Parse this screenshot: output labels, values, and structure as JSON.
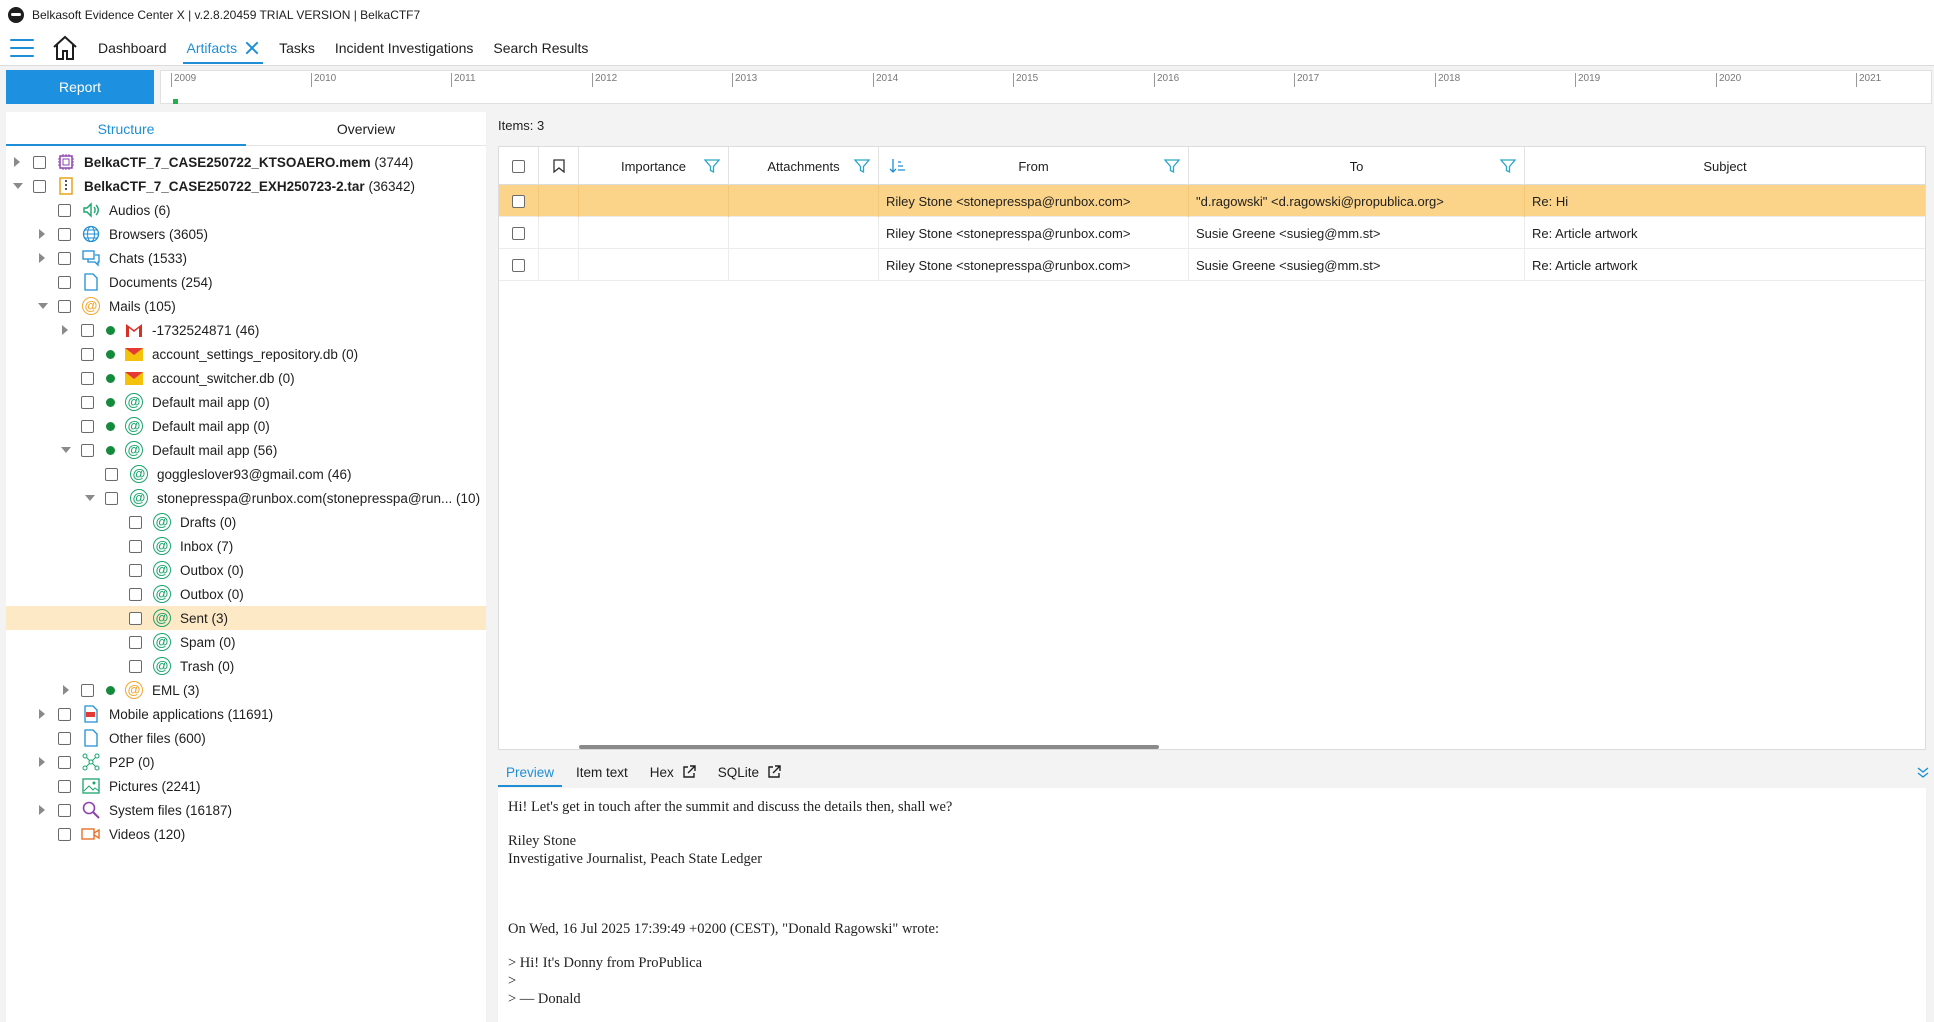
{
  "window": {
    "title": "Belkasoft Evidence Center X | v.2.8.20459 TRIAL VERSION | BelkaCTF7"
  },
  "nav": {
    "tabs": [
      {
        "label": "Dashboard"
      },
      {
        "label": "Artifacts"
      },
      {
        "label": "Tasks"
      },
      {
        "label": "Incident Investigations"
      },
      {
        "label": "Search Results"
      }
    ]
  },
  "report_button": "Report",
  "timeline": {
    "years": [
      "2009",
      "2010",
      "2011",
      "2012",
      "2013",
      "2014",
      "2015",
      "2016",
      "2017",
      "2018",
      "2019",
      "2020",
      "2021"
    ]
  },
  "left_panel": {
    "tabs": [
      {
        "label": "Structure"
      },
      {
        "label": "Overview"
      }
    ],
    "tree": [
      {
        "name": "BelkaCTF_7_CASE250722_KTSOAERO.mem",
        "count": "(3744)",
        "icon": "memory-chip-icon"
      },
      {
        "name": "BelkaCTF_7_CASE250722_EXH250723-2.tar",
        "count": "(36342)",
        "icon": "archive-icon"
      },
      {
        "label": "Audios (6)",
        "icon": "speaker-icon"
      },
      {
        "label": "Browsers (3605)",
        "icon": "globe-icon"
      },
      {
        "label": "Chats (1533)",
        "icon": "chat-icon"
      },
      {
        "label": "Documents (254)",
        "icon": "document-icon"
      },
      {
        "label": "Mails (105)",
        "icon": "at-icon"
      },
      {
        "label": "-1732524871 (46)",
        "icon": "gmail-icon"
      },
      {
        "label": "account_settings_repository.db (0)",
        "icon": "envelope-icon"
      },
      {
        "label": "account_switcher.db (0)",
        "icon": "envelope-icon"
      },
      {
        "label": "Default mail app (0)",
        "icon": "at-icon"
      },
      {
        "label": "Default mail app (0)",
        "icon": "at-icon"
      },
      {
        "label": "Default mail app (56)",
        "icon": "at-icon"
      },
      {
        "label": "goggleslover93@gmail.com (46)",
        "icon": "at-icon"
      },
      {
        "label": "stonepresspa@runbox.com(stonepresspa@run...  (10)",
        "icon": "at-icon"
      },
      {
        "label": "Drafts (0)",
        "icon": "at-icon"
      },
      {
        "label": "Inbox (7)",
        "icon": "at-icon"
      },
      {
        "label": "Outbox (0)",
        "icon": "at-icon"
      },
      {
        "label": "Outbox (0)",
        "icon": "at-icon"
      },
      {
        "label": "Sent (3)",
        "icon": "at-icon"
      },
      {
        "label": "Spam (0)",
        "icon": "at-icon"
      },
      {
        "label": "Trash (0)",
        "icon": "at-icon"
      },
      {
        "label": "EML (3)",
        "icon": "at-icon"
      },
      {
        "label": "Mobile applications (11691)",
        "icon": "app-icon"
      },
      {
        "label": "Other files (600)",
        "icon": "document-icon"
      },
      {
        "label": "P2P (0)",
        "icon": "p2p-icon"
      },
      {
        "label": "Pictures (2241)",
        "icon": "picture-icon"
      },
      {
        "label": "System files (16187)",
        "icon": "magnifier-icon"
      },
      {
        "label": "Videos (120)",
        "icon": "video-icon"
      }
    ]
  },
  "grid": {
    "items_label": "Items: 3",
    "columns": [
      "Importance",
      "Attachments",
      "From",
      "To",
      "Subject"
    ],
    "rows": [
      {
        "from": "Riley Stone <stonepresspa@runbox.com>",
        "to": "\"d.ragowski\" <d.ragowski@propublica.org>",
        "subject": "Re: Hi"
      },
      {
        "from": "Riley Stone <stonepresspa@runbox.com>",
        "to": "Susie Greene <susieg@mm.st>",
        "subject": "Re: Article artwork"
      },
      {
        "from": "Riley Stone <stonepresspa@runbox.com>",
        "to": "Susie Greene <susieg@mm.st>",
        "subject": "Re: Article artwork"
      }
    ]
  },
  "preview": {
    "tabs": [
      {
        "label": "Preview"
      },
      {
        "label": "Item text"
      },
      {
        "label": "Hex"
      },
      {
        "label": "SQLite"
      }
    ],
    "lines": [
      "Hi! Let's get in touch after the summit and discuss the details then, shall we?",
      "Riley Stone",
      "Investigative Journalist, Peach State Ledger",
      "On Wed, 16 Jul 2025 17:39:49 +0200 (CEST), \"Donald Ragowski\" wrote:",
      "> Hi! It's Donny from ProPublica",
      ">",
      "> — Donald"
    ]
  },
  "colors": {
    "accent": "#1e8fd6",
    "selected_row": "#fbd48a",
    "selected_tree": "#fde9c6",
    "report_button": "#1e90e0"
  }
}
